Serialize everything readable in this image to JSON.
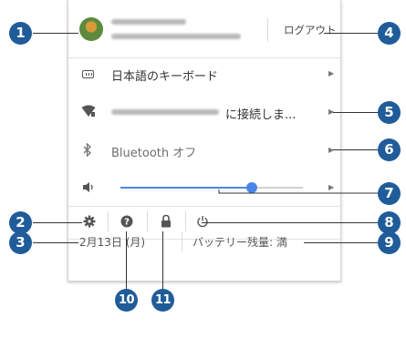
{
  "account": {
    "logout_label": "ログアウト"
  },
  "keyboard": {
    "label": "日本語のキーボード",
    "icon": "keyboard-icon"
  },
  "network": {
    "status_suffix": "に接続しま...",
    "icon": "wifi-icon"
  },
  "bluetooth": {
    "label": "Bluetooth オフ",
    "icon": "bluetooth-icon"
  },
  "volume": {
    "icon": "volume-icon",
    "level": 0.72
  },
  "toolbar": {
    "settings_icon": "gear-icon",
    "help_icon": "help-icon",
    "lock_icon": "lock-icon",
    "power_icon": "power-icon"
  },
  "footer": {
    "date": "2月13日 (月)",
    "battery": "バッテリー残量: 満"
  },
  "callouts": [
    "1",
    "2",
    "3",
    "4",
    "5",
    "6",
    "7",
    "8",
    "9",
    "10",
    "11"
  ],
  "colors": {
    "callout": "#1f5c99",
    "slider": "#4a86e8"
  }
}
